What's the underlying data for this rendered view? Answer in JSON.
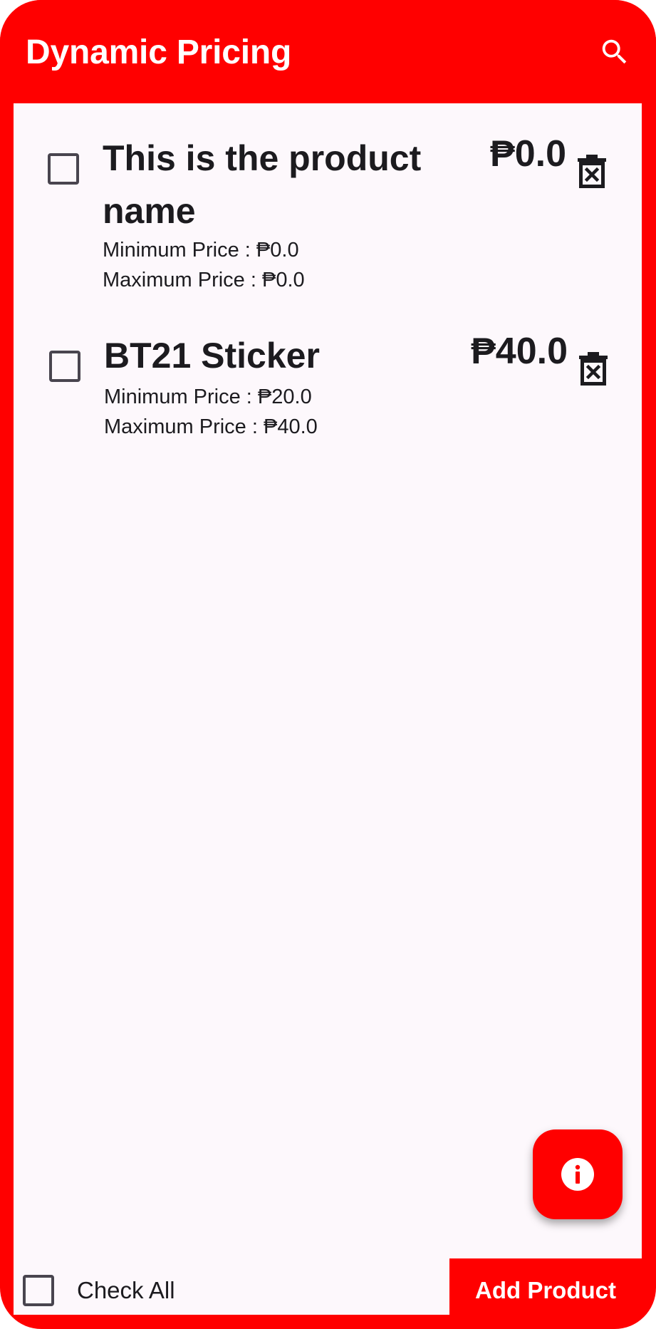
{
  "app": {
    "title": "Dynamic Pricing",
    "accent_color": "#ff0000",
    "content_background": "#fdf8fc"
  },
  "header": {
    "search_icon": "search-icon"
  },
  "products": [
    {
      "name": "This is the product name",
      "price": "₱0.0",
      "min_price": "Minimum Price : ₱0.0",
      "max_price": "Maximum Price : ₱0.0",
      "checked": false,
      "delete_icon": "delete-icon"
    },
    {
      "name": "BT21 Sticker",
      "price": "₱40.0",
      "min_price": "Minimum Price : ₱20.0",
      "max_price": "Maximum Price : ₱40.0",
      "checked": false,
      "delete_icon": "delete-icon"
    }
  ],
  "fab": {
    "icon": "info-icon"
  },
  "footer": {
    "check_all_label": "Check All",
    "check_all_checked": false,
    "add_product_label": "Add Product"
  }
}
